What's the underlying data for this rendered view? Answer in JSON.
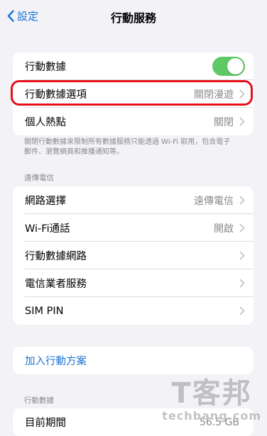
{
  "nav": {
    "back_label": "設定",
    "title": "行動服務"
  },
  "group1": {
    "row1": {
      "label": "行動數據",
      "toggle_on": true
    },
    "row2": {
      "label": "行動數據選項",
      "value": "關閉漫遊"
    },
    "row3": {
      "label": "個人熱點",
      "value": "關閉"
    }
  },
  "footnote": "關閉行動數據來限制所有數據服務只能透過 Wi-Fi 取用，包含電子郵件、瀏覽網頁和推播通知等。",
  "carrier_header": "遠傳電信",
  "group2": {
    "row1": {
      "label": "網路選擇",
      "value": "遠傳電信"
    },
    "row2": {
      "label": "Wi-Fi通話",
      "value": "開啟"
    },
    "row3": {
      "label": "行動數據網路"
    },
    "row4": {
      "label": "電信業者服務"
    },
    "row5": {
      "label": "SIM PIN"
    }
  },
  "group3": {
    "add_plan_label": "加入行動方案"
  },
  "data_header": "行動數據",
  "group4": {
    "row1": {
      "label": "目前期間",
      "value": "56.5 GB"
    }
  },
  "watermark": {
    "logo": "T客邦",
    "text": "techbang.com"
  },
  "colors": {
    "accent": "#1a73d8",
    "toggle_on": "#5ec966",
    "highlight": "#e4111b"
  }
}
